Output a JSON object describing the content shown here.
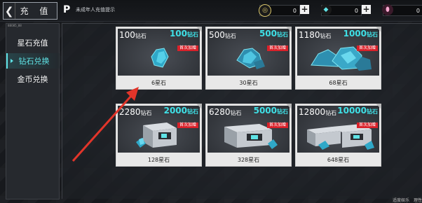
{
  "header": {
    "back_title": "充 值",
    "notice": "未成年人充值提示",
    "resources": [
      {
        "name": "gold",
        "value": "0",
        "icon": "gold-coin-icon"
      },
      {
        "name": "diamond",
        "value": "0",
        "icon": "diamond-icon"
      },
      {
        "name": "star",
        "value": "0",
        "icon": "star-stone-icon"
      }
    ]
  },
  "sidebar": {
    "tag": "88085_88",
    "items": [
      {
        "label": "星石充值",
        "active": false
      },
      {
        "label": "钻石兑换",
        "active": true
      },
      {
        "label": "金币兑换",
        "active": false
      }
    ]
  },
  "cards": [
    {
      "price": "100",
      "price_unit": "钻石",
      "bonus": "100",
      "bonus_unit": "钻石",
      "badge": "首次加赠",
      "label": "6星石"
    },
    {
      "price": "500",
      "price_unit": "钻石",
      "bonus": "500",
      "bonus_unit": "钻石",
      "badge": "首次加赠",
      "label": "30星石"
    },
    {
      "price": "1180",
      "price_unit": "钻石",
      "bonus": "1000",
      "bonus_unit": "钻石",
      "badge": "首次加赠",
      "label": "68星石"
    },
    {
      "price": "2280",
      "price_unit": "钻石",
      "bonus": "2000",
      "bonus_unit": "钻石",
      "badge": "首次加赠",
      "label": "128星石"
    },
    {
      "price": "6280",
      "price_unit": "钻石",
      "bonus": "5000",
      "bonus_unit": "钻石",
      "badge": "首次加赠",
      "label": "328星石"
    },
    {
      "price": "12800",
      "price_unit": "钻石",
      "bonus": "10000",
      "bonus_unit": "钻石",
      "badge": "首次加赠",
      "label": "648星石"
    }
  ],
  "footer": {
    "left": "适度娱乐",
    "right": "理性"
  },
  "colors": {
    "accent": "#3fe0e6",
    "badge": "#d9212a",
    "arrow": "#e2352a"
  }
}
